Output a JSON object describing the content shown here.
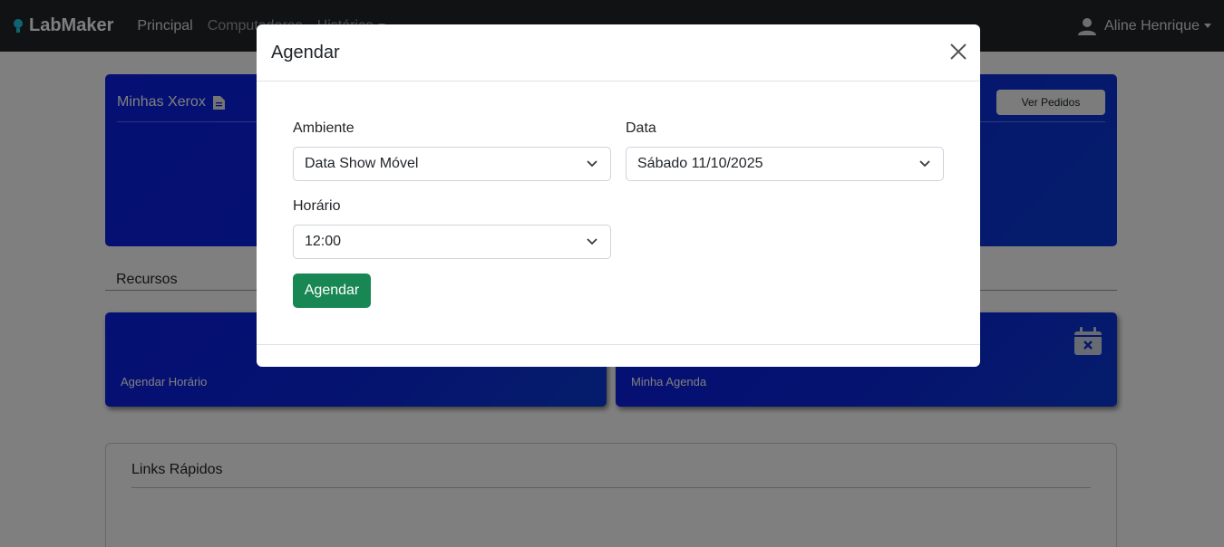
{
  "navbar": {
    "brand": "LabMaker",
    "links": [
      "Principal",
      "Computadores",
      "Histórico"
    ],
    "user": "Aline Henrique"
  },
  "background": {
    "xerox_title": "Minhas Xerox",
    "ver_pedidos": "Ver Pedidos",
    "recursos_title": "Recursos",
    "resource_cards": [
      "Agendar Horário",
      "Minha Agenda"
    ],
    "links_title": "Links Rápidos"
  },
  "modal": {
    "title": "Agendar",
    "fields": {
      "ambiente": {
        "label": "Ambiente",
        "value": "Data Show Móvel"
      },
      "data": {
        "label": "Data",
        "value": "Sábado 11/10/2025"
      },
      "horario": {
        "label": "Horário",
        "value": "12:00"
      }
    },
    "submit_label": "Agendar"
  },
  "colors": {
    "navbar": "#212529",
    "card_blue": "#0a1fe8",
    "success": "#198754"
  }
}
